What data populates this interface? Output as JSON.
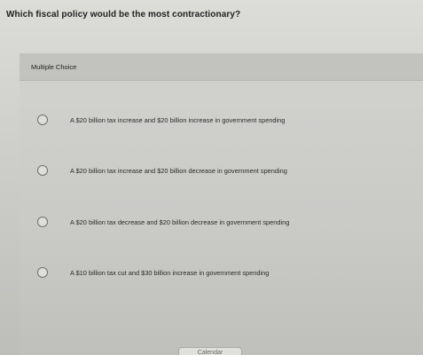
{
  "question": {
    "text": "Which fiscal policy would be the most contractionary?"
  },
  "section": {
    "label": "Multiple Choice"
  },
  "options": [
    {
      "label": "A $20 billion tax increase and $20 billion increase in government spending",
      "selected": false
    },
    {
      "label": "A $20 billion tax increase and $20 billion decrease in government spending",
      "selected": false
    },
    {
      "label": "A $20 billion tax decrease and $20 billion decrease in government spending",
      "selected": false
    },
    {
      "label": "A $10 billion tax cut and $30 billion increase in government spending",
      "selected": false
    }
  ],
  "footer": {
    "calendar_label": "Calendar"
  }
}
